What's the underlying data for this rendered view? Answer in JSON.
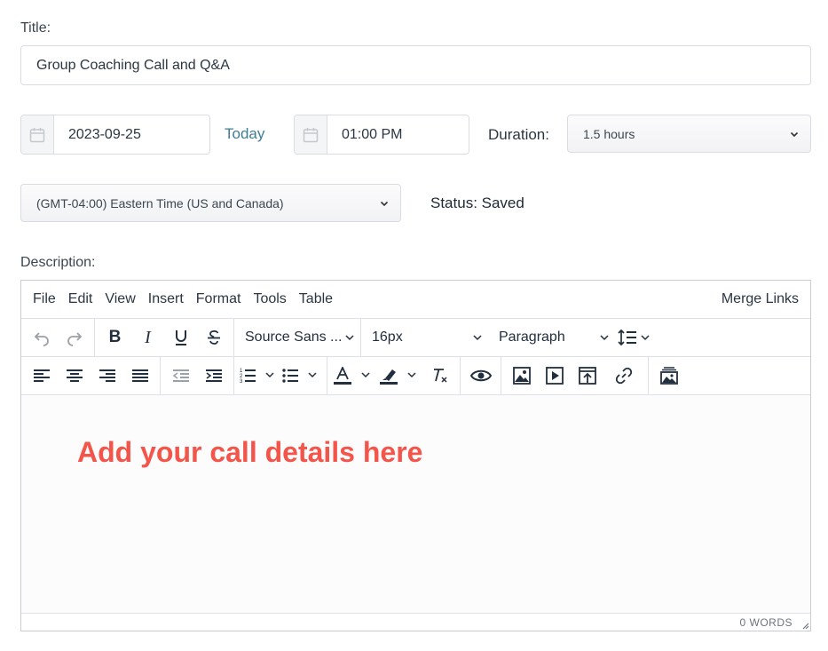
{
  "form": {
    "title_label": "Title:",
    "title_value": "Group Coaching Call and Q&A",
    "date_value": "2023-09-25",
    "today_link": "Today",
    "time_value": "01:00 PM",
    "duration_label": "Duration:",
    "duration_value": "1.5 hours",
    "timezone_value": "(GMT-04:00) Eastern Time (US and Canada)",
    "status_text": "Status: Saved",
    "description_label": "Description:"
  },
  "editor": {
    "menu": [
      "File",
      "Edit",
      "View",
      "Insert",
      "Format",
      "Tools",
      "Table"
    ],
    "merge_links": "Merge Links",
    "font_family": "Source Sans ...",
    "font_size": "16px",
    "block_format": "Paragraph",
    "content_text": "Add your call details here",
    "content_color": "#f4554a",
    "word_count": "0 WORDS"
  },
  "icons": {
    "calendar": "calendar-icon",
    "undo": "undo-icon",
    "redo": "redo-icon",
    "bold": "bold-icon",
    "italic": "italic-icon",
    "underline": "underline-icon",
    "strike": "strikethrough-icon",
    "line_height": "line-height-icon",
    "align_left": "align-left-icon",
    "align_center": "align-center-icon",
    "align_right": "align-right-icon",
    "justify": "align-justify-icon",
    "outdent": "outdent-icon",
    "indent": "indent-icon",
    "numbered_list": "numbered-list-icon",
    "bullet_list": "bullet-list-icon",
    "text_color": "text-color-icon",
    "highlight": "highlight-icon",
    "clear_format": "clear-formatting-icon",
    "preview": "preview-eye-icon",
    "image": "image-icon",
    "media": "media-icon",
    "upload": "upload-icon",
    "link": "link-icon",
    "gallery": "gallery-icon"
  }
}
